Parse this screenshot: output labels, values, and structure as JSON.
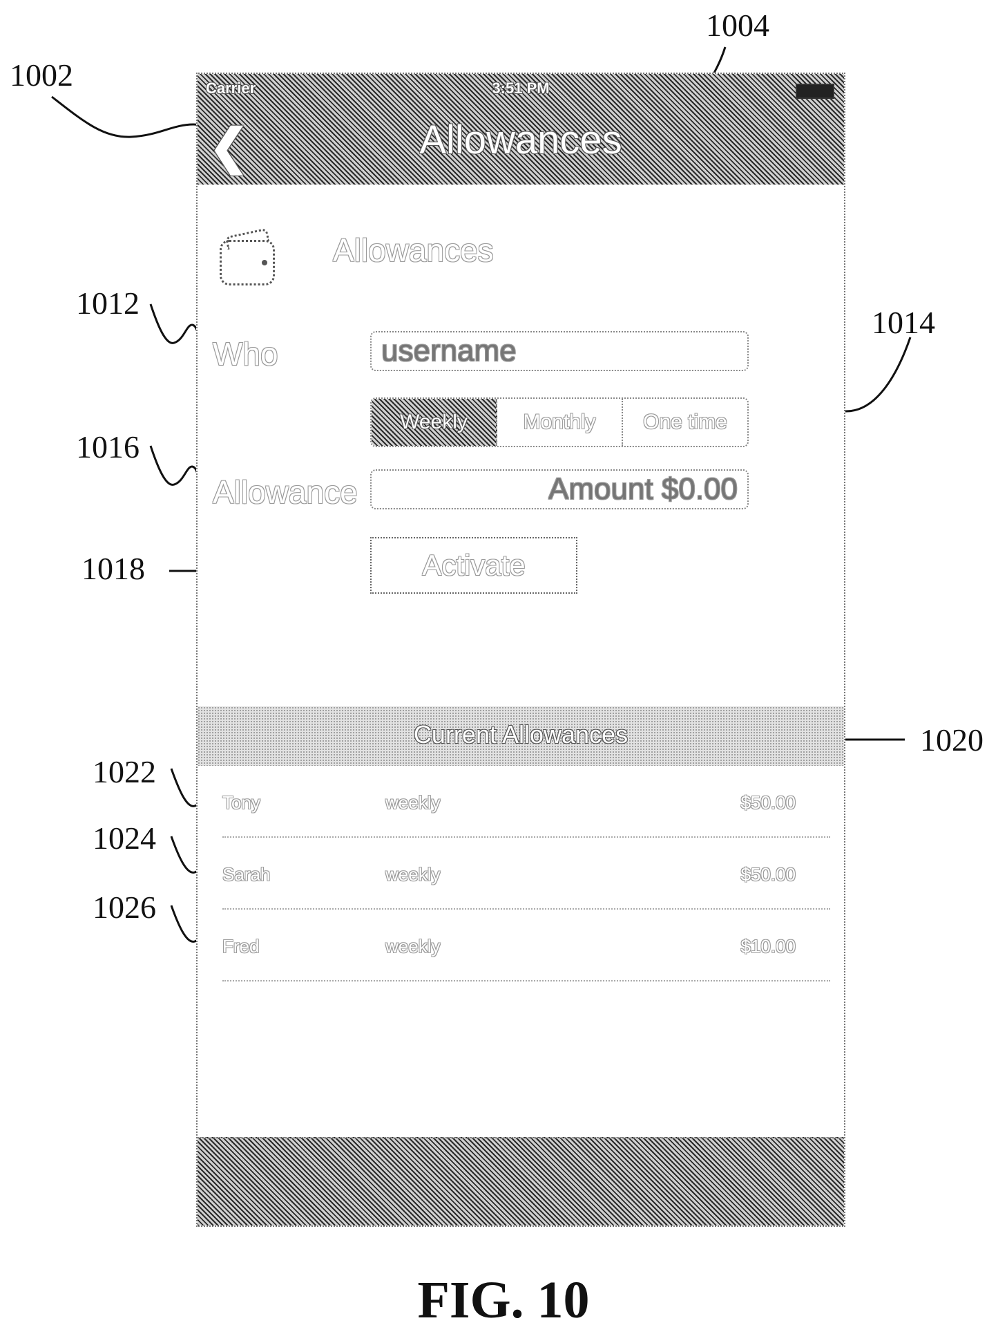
{
  "status_bar": {
    "carrier": "Carrier",
    "time": "3:51 PM"
  },
  "nav": {
    "title": "Allowances"
  },
  "section": {
    "title": "Allowances"
  },
  "form": {
    "who_label": "Who",
    "who_placeholder": "username",
    "frequency_options": [
      "Weekly",
      "Monthly",
      "One time"
    ],
    "allowance_label": "Allowance",
    "amount_placeholder": "Amount $0.00",
    "activate_label": "Activate"
  },
  "current": {
    "title": "Current Allowances",
    "rows": [
      {
        "name": "Tony",
        "frequency": "weekly",
        "amount": "$50.00"
      },
      {
        "name": "Sarah",
        "frequency": "weekly",
        "amount": "$50.00"
      },
      {
        "name": "Fred",
        "frequency": "weekly",
        "amount": "$10.00"
      }
    ]
  },
  "callouts": {
    "back": "1002",
    "title": "1004",
    "who": "1012",
    "segmented": "1014",
    "allowance": "1016",
    "activate": "1018",
    "current_header": "1020",
    "row1": "1022",
    "row2": "1024",
    "row3": "1026"
  },
  "figure_label": "FIG. 10"
}
